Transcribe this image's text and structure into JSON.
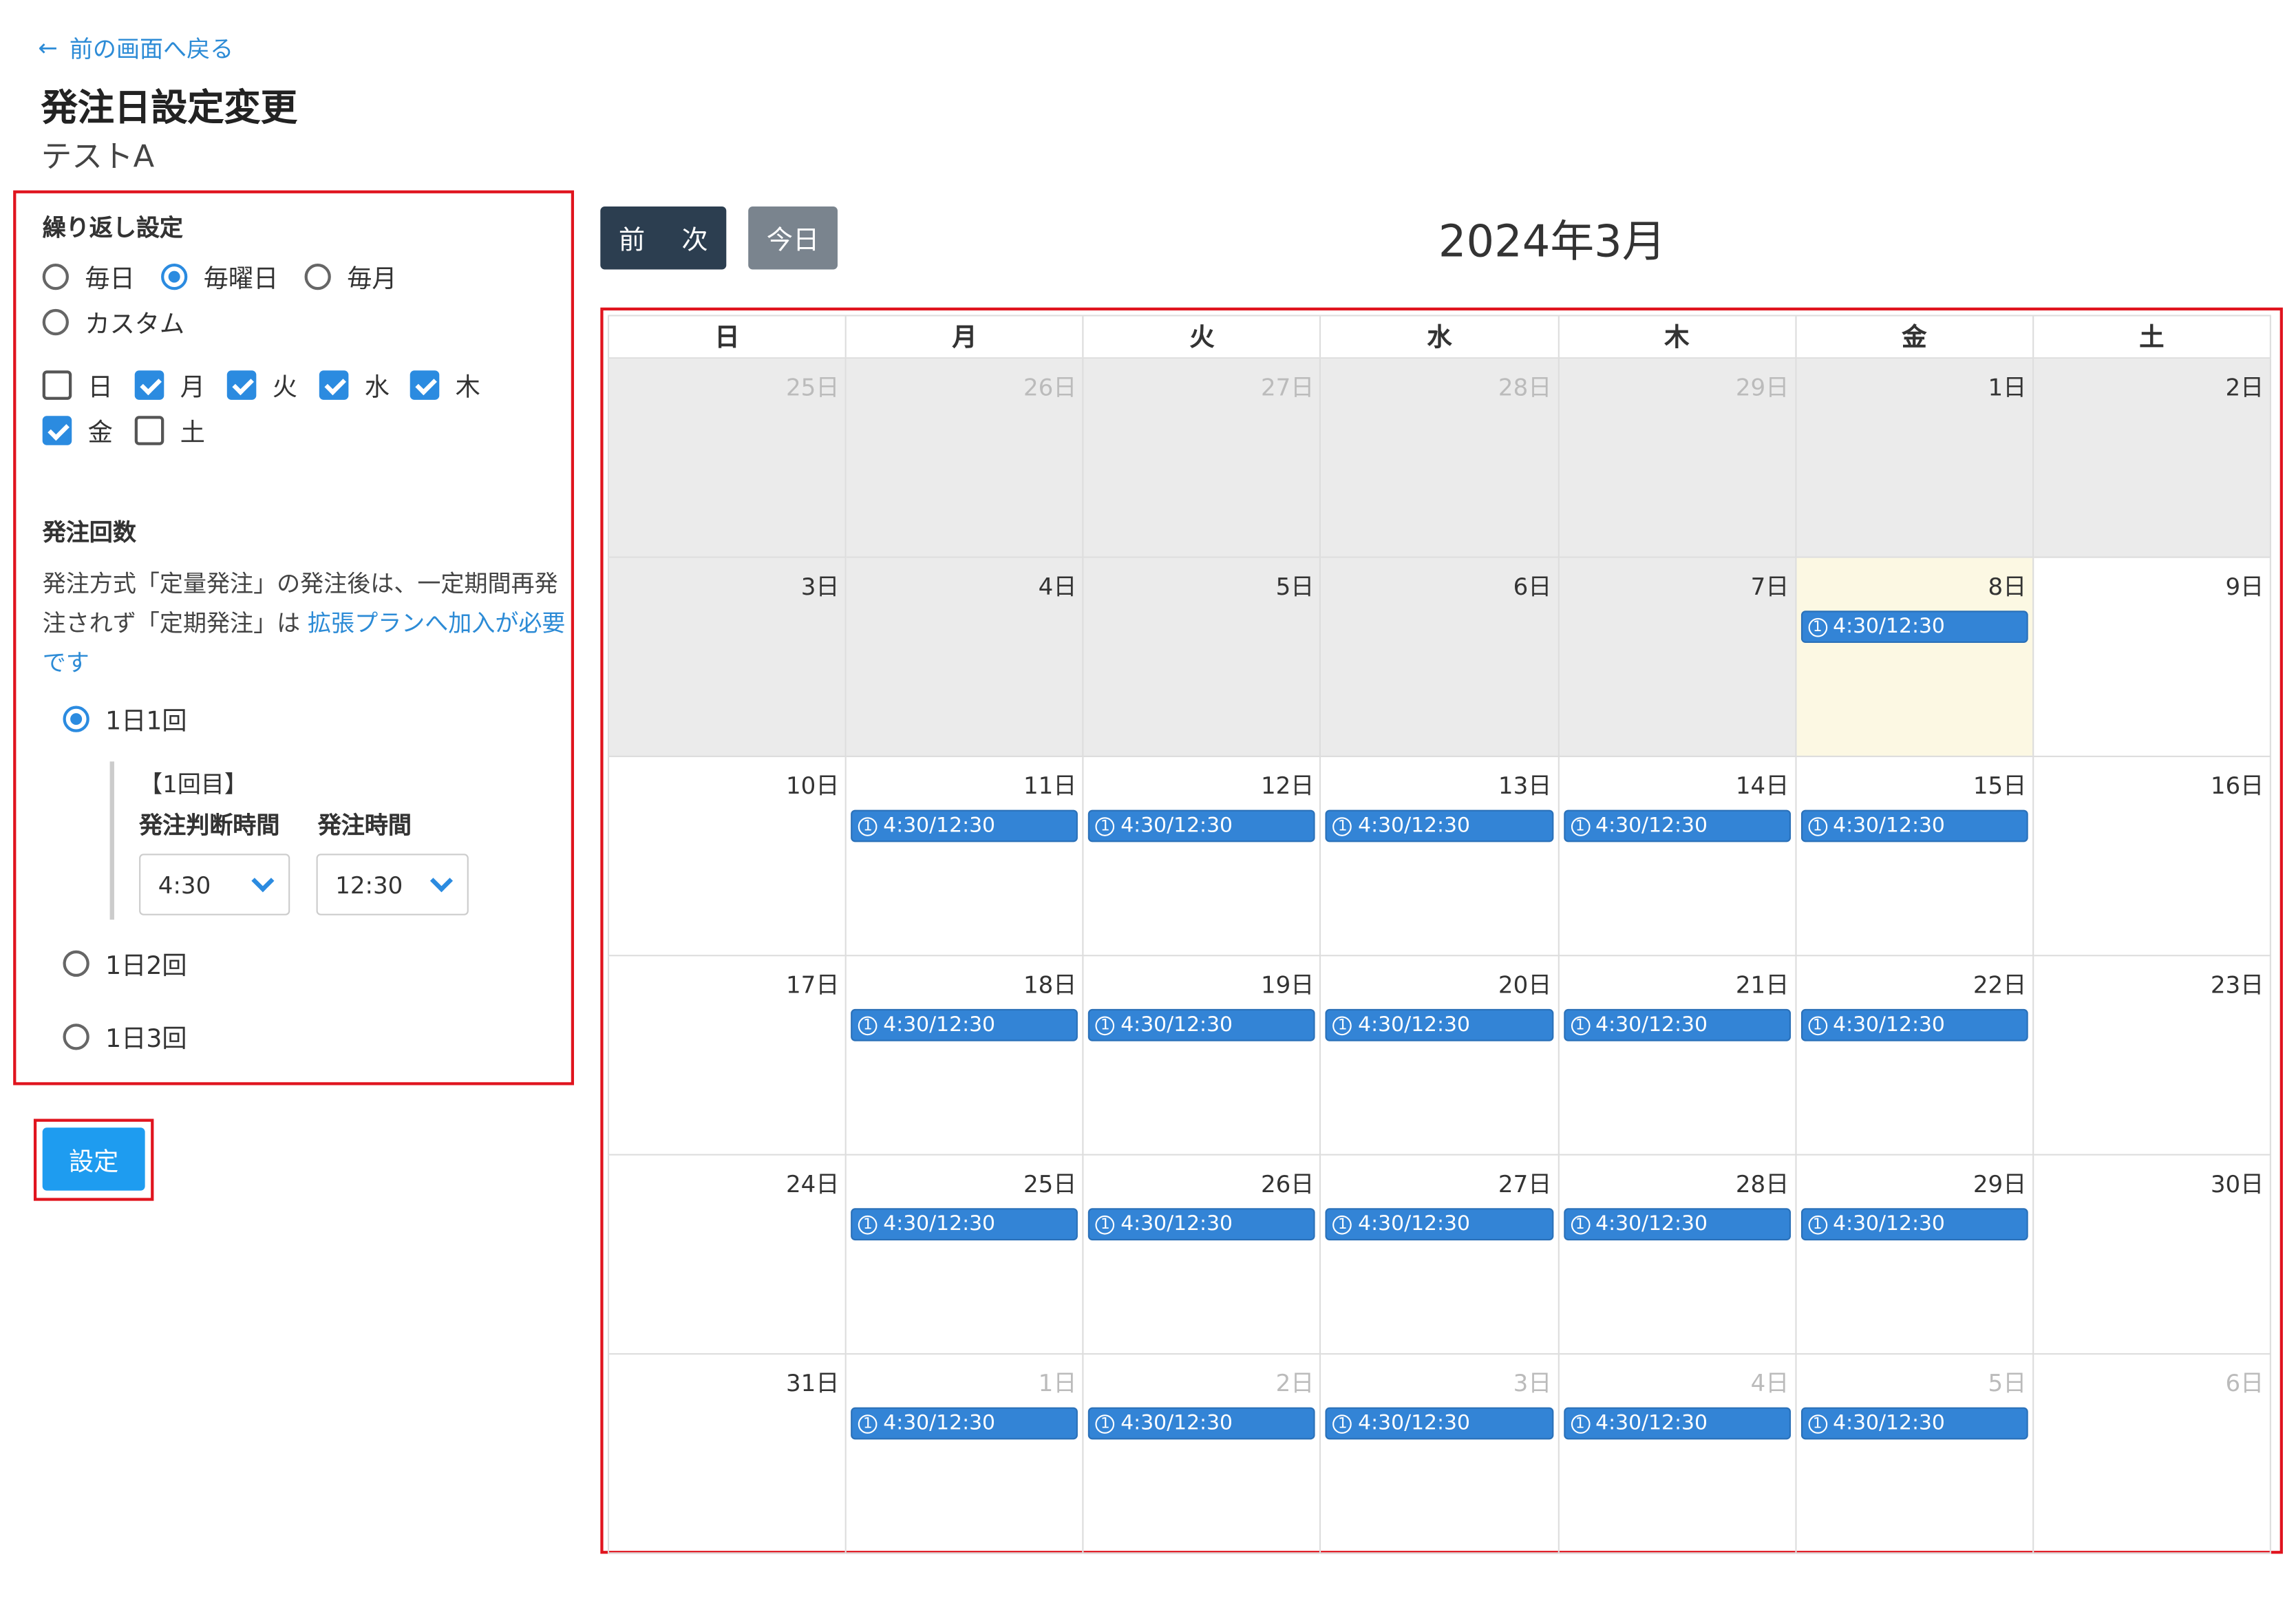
{
  "header": {
    "back_label": "前の画面へ戻る",
    "back_icon": "arrow-left-icon",
    "title": "発注日設定変更",
    "subtitle": "テストA"
  },
  "repeat": {
    "label": "繰り返し設定",
    "options": [
      {
        "label": "毎日",
        "checked": false
      },
      {
        "label": "毎曜日",
        "checked": true
      },
      {
        "label": "毎月",
        "checked": false
      },
      {
        "label": "カスタム",
        "checked": false
      }
    ],
    "weekdays": [
      {
        "label": "日",
        "checked": false
      },
      {
        "label": "月",
        "checked": true
      },
      {
        "label": "火",
        "checked": true
      },
      {
        "label": "水",
        "checked": true
      },
      {
        "label": "木",
        "checked": true
      },
      {
        "label": "金",
        "checked": true
      },
      {
        "label": "土",
        "checked": false
      }
    ]
  },
  "order_count": {
    "label": "発注回数",
    "desc_1": "発注方式「定量発注」の発注後は、一定期間再発注されず「定期発注」は ",
    "desc_link": "拡張プランへ加入が必要です",
    "options": [
      {
        "label": "1日1回",
        "checked": true
      },
      {
        "label": "1日2回",
        "checked": false
      },
      {
        "label": "1日3回",
        "checked": false
      }
    ],
    "first_title": "【1回目】",
    "judge_label": "発注判断時間",
    "order_label": "発注時間",
    "judge_value": "4:30",
    "order_value": "12:30"
  },
  "submit_label": "設定",
  "calendar": {
    "prev_label": "前",
    "next_label": "次",
    "today_label": "今日",
    "month_title": "2024年3月",
    "weekday_headers": [
      "日",
      "月",
      "火",
      "水",
      "木",
      "金",
      "土"
    ],
    "event_label": "4:30/12:30",
    "event_icon": "①",
    "weeks": [
      [
        {
          "day": "25日",
          "other": true,
          "past": true,
          "event": false
        },
        {
          "day": "26日",
          "other": true,
          "past": true,
          "event": false
        },
        {
          "day": "27日",
          "other": true,
          "past": true,
          "event": false
        },
        {
          "day": "28日",
          "other": true,
          "past": true,
          "event": false
        },
        {
          "day": "29日",
          "other": true,
          "past": true,
          "event": false
        },
        {
          "day": "1日",
          "other": false,
          "past": true,
          "event": false
        },
        {
          "day": "2日",
          "other": false,
          "past": true,
          "event": false
        }
      ],
      [
        {
          "day": "3日",
          "other": false,
          "past": true,
          "event": false
        },
        {
          "day": "4日",
          "other": false,
          "past": true,
          "event": false
        },
        {
          "day": "5日",
          "other": false,
          "past": true,
          "event": false
        },
        {
          "day": "6日",
          "other": false,
          "past": true,
          "event": false
        },
        {
          "day": "7日",
          "other": false,
          "past": true,
          "event": false
        },
        {
          "day": "8日",
          "other": false,
          "today": true,
          "event": true
        },
        {
          "day": "9日",
          "other": false,
          "event": false
        }
      ],
      [
        {
          "day": "10日",
          "other": false,
          "event": false
        },
        {
          "day": "11日",
          "other": false,
          "event": true
        },
        {
          "day": "12日",
          "other": false,
          "event": true
        },
        {
          "day": "13日",
          "other": false,
          "event": true
        },
        {
          "day": "14日",
          "other": false,
          "event": true
        },
        {
          "day": "15日",
          "other": false,
          "event": true
        },
        {
          "day": "16日",
          "other": false,
          "event": false
        }
      ],
      [
        {
          "day": "17日",
          "other": false,
          "event": false
        },
        {
          "day": "18日",
          "other": false,
          "event": true
        },
        {
          "day": "19日",
          "other": false,
          "event": true
        },
        {
          "day": "20日",
          "other": false,
          "event": true
        },
        {
          "day": "21日",
          "other": false,
          "event": true
        },
        {
          "day": "22日",
          "other": false,
          "event": true
        },
        {
          "day": "23日",
          "other": false,
          "event": false
        }
      ],
      [
        {
          "day": "24日",
          "other": false,
          "event": false
        },
        {
          "day": "25日",
          "other": false,
          "event": true
        },
        {
          "day": "26日",
          "other": false,
          "event": true
        },
        {
          "day": "27日",
          "other": false,
          "event": true
        },
        {
          "day": "28日",
          "other": false,
          "event": true
        },
        {
          "day": "29日",
          "other": false,
          "event": true
        },
        {
          "day": "30日",
          "other": false,
          "event": false
        }
      ],
      [
        {
          "day": "31日",
          "other": false,
          "event": false
        },
        {
          "day": "1日",
          "other": true,
          "event": true
        },
        {
          "day": "2日",
          "other": true,
          "event": true
        },
        {
          "day": "3日",
          "other": true,
          "event": true
        },
        {
          "day": "4日",
          "other": true,
          "event": true
        },
        {
          "day": "5日",
          "other": true,
          "event": true
        },
        {
          "day": "6日",
          "other": true,
          "event": false
        }
      ]
    ]
  }
}
